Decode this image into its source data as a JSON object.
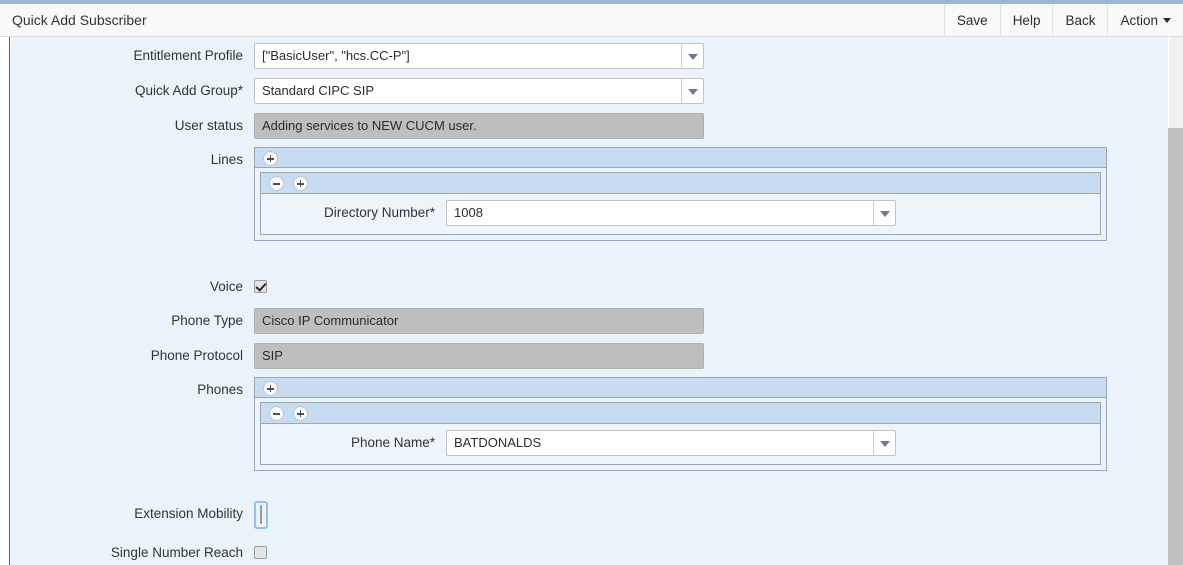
{
  "window": {
    "title": "Quick Add Subscriber"
  },
  "toolbar": {
    "save_label": "Save",
    "help_label": "Help",
    "back_label": "Back",
    "action_label": "Action"
  },
  "form": {
    "entitlement_profile": {
      "label": "Entitlement Profile",
      "value": "[\"BasicUser\", \"hcs.CC-P\"]"
    },
    "quick_add_group": {
      "label": "Quick Add Group*",
      "value": "Standard CIPC SIP"
    },
    "user_status": {
      "label": "User status",
      "value": "Adding services to NEW CUCM user."
    },
    "lines": {
      "label": "Lines",
      "add_label": "+",
      "remove_label": "−",
      "directory_number": {
        "label": "Directory Number*",
        "value": "1008"
      }
    },
    "voice": {
      "label": "Voice",
      "checked": true
    },
    "phone_type": {
      "label": "Phone Type",
      "value": "Cisco IP Communicator"
    },
    "phone_protocol": {
      "label": "Phone Protocol",
      "value": "SIP"
    },
    "phones": {
      "label": "Phones",
      "add_label": "+",
      "remove_label": "−",
      "phone_name": {
        "label": "Phone Name*",
        "value": "BATDONALDS"
      }
    },
    "extension_mobility": {
      "label": "Extension Mobility",
      "checked": false
    },
    "single_number_reach": {
      "label": "Single Number Reach",
      "checked": false
    }
  },
  "colors": {
    "accent_bar": "#9cb6d8",
    "group_header": "#c7dcf0",
    "canvas": "#eaf2fb",
    "disabled_field": "#bebebe",
    "focus_ring": "#93c0ef"
  }
}
